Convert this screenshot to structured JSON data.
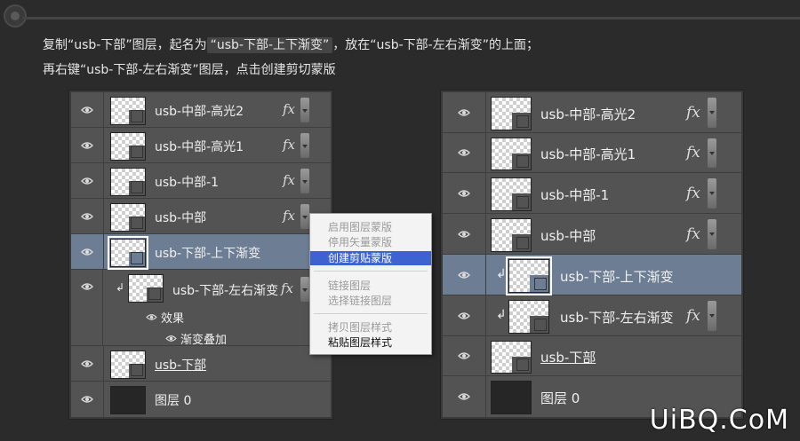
{
  "instructions": {
    "line1_a": "复制“usb-下部”图层，起名为",
    "line1_hl": "“usb-下部-上下渐变”",
    "line1_b": "，放在“usb-下部-左右渐变”的上面；",
    "line2": "再右键“usb-下部-左右渐变”图层，点击创建剪切蒙版"
  },
  "left_panel": {
    "layers": [
      {
        "name": "usb-中部-高光2",
        "fx": "fx"
      },
      {
        "name": "usb-中部-高光1",
        "fx": "fx"
      },
      {
        "name": "usb-中部-1",
        "fx": "fx"
      },
      {
        "name": "usb-中部",
        "fx": "fx"
      },
      {
        "name": "usb-下部-上下渐变"
      },
      {
        "name": "usb-下部-左右渐变",
        "fx": "fx"
      },
      {
        "name": "usb-下部"
      },
      {
        "name": "图层 0"
      }
    ],
    "effects_label": "效果",
    "effect_item": "渐变叠加"
  },
  "context_menu": {
    "items": [
      "启用图层蒙版",
      "停用矢量蒙版",
      "创建剪贴蒙版",
      "链接图层",
      "选择链接图层",
      "拷贝图层样式",
      "粘贴图层样式"
    ]
  },
  "right_panel": {
    "layers": [
      {
        "name": "usb-中部-高光2",
        "fx": "fx"
      },
      {
        "name": "usb-中部-高光1",
        "fx": "fx"
      },
      {
        "name": "usb-中部-1",
        "fx": "fx"
      },
      {
        "name": "usb-中部",
        "fx": "fx"
      },
      {
        "name": "usb-下部-上下渐变"
      },
      {
        "name": "usb-下部-左右渐变",
        "fx": "fx"
      },
      {
        "name": "usb-下部"
      },
      {
        "name": "图层 0"
      }
    ]
  },
  "watermark": "UiBQ.CoM",
  "colors": {
    "selected_row": "#6d7e94",
    "menu_highlight": "#3d63d2",
    "panel_bg": "#535353"
  }
}
